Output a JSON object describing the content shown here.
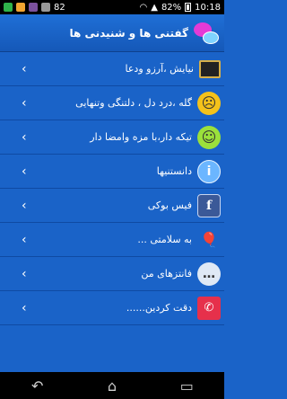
{
  "status_bar": {
    "left_number": "82",
    "battery": "82%",
    "time": "10:18",
    "icons": [
      "notification-icon",
      "image-icon",
      "viber-icon",
      "sim-icon",
      "wifi-icon",
      "signal-icon",
      "battery-icon"
    ]
  },
  "header": {
    "title": "گفتنی ها و شنیدنی ها",
    "logo_icon": "speech-bubbles-icon"
  },
  "rows": [
    {
      "label": "نیایش ،آرزو ودعا",
      "icon": "kaaba-icon",
      "glyph": ""
    },
    {
      "label": "گله ،درد دل ، دلتنگی وتنهایی",
      "icon": "sad-face-icon",
      "glyph": "☹"
    },
    {
      "label": "تیکه دار،با مزه وامضا دار",
      "icon": "smiley-icon",
      "glyph": "☺"
    },
    {
      "label": "دانستنیها",
      "icon": "info-icon",
      "glyph": "i"
    },
    {
      "label": "فیس بوکی",
      "icon": "facebook-icon",
      "glyph": "f"
    },
    {
      "label": "به سلامتی ...",
      "icon": "balloons-icon",
      "glyph": "🎈"
    },
    {
      "label": "فانتزهای من",
      "icon": "chat-bubble-icon",
      "glyph": "…"
    },
    {
      "label": "دقت کردین......",
      "icon": "phone-icon",
      "glyph": "✆"
    }
  ],
  "chevron": "‹",
  "nav": {
    "back": "↶",
    "home": "⌂",
    "recents": "▭"
  },
  "colors": {
    "background": "#1a63c8",
    "header": "#1558b8",
    "divider": "#0f4aa3"
  }
}
